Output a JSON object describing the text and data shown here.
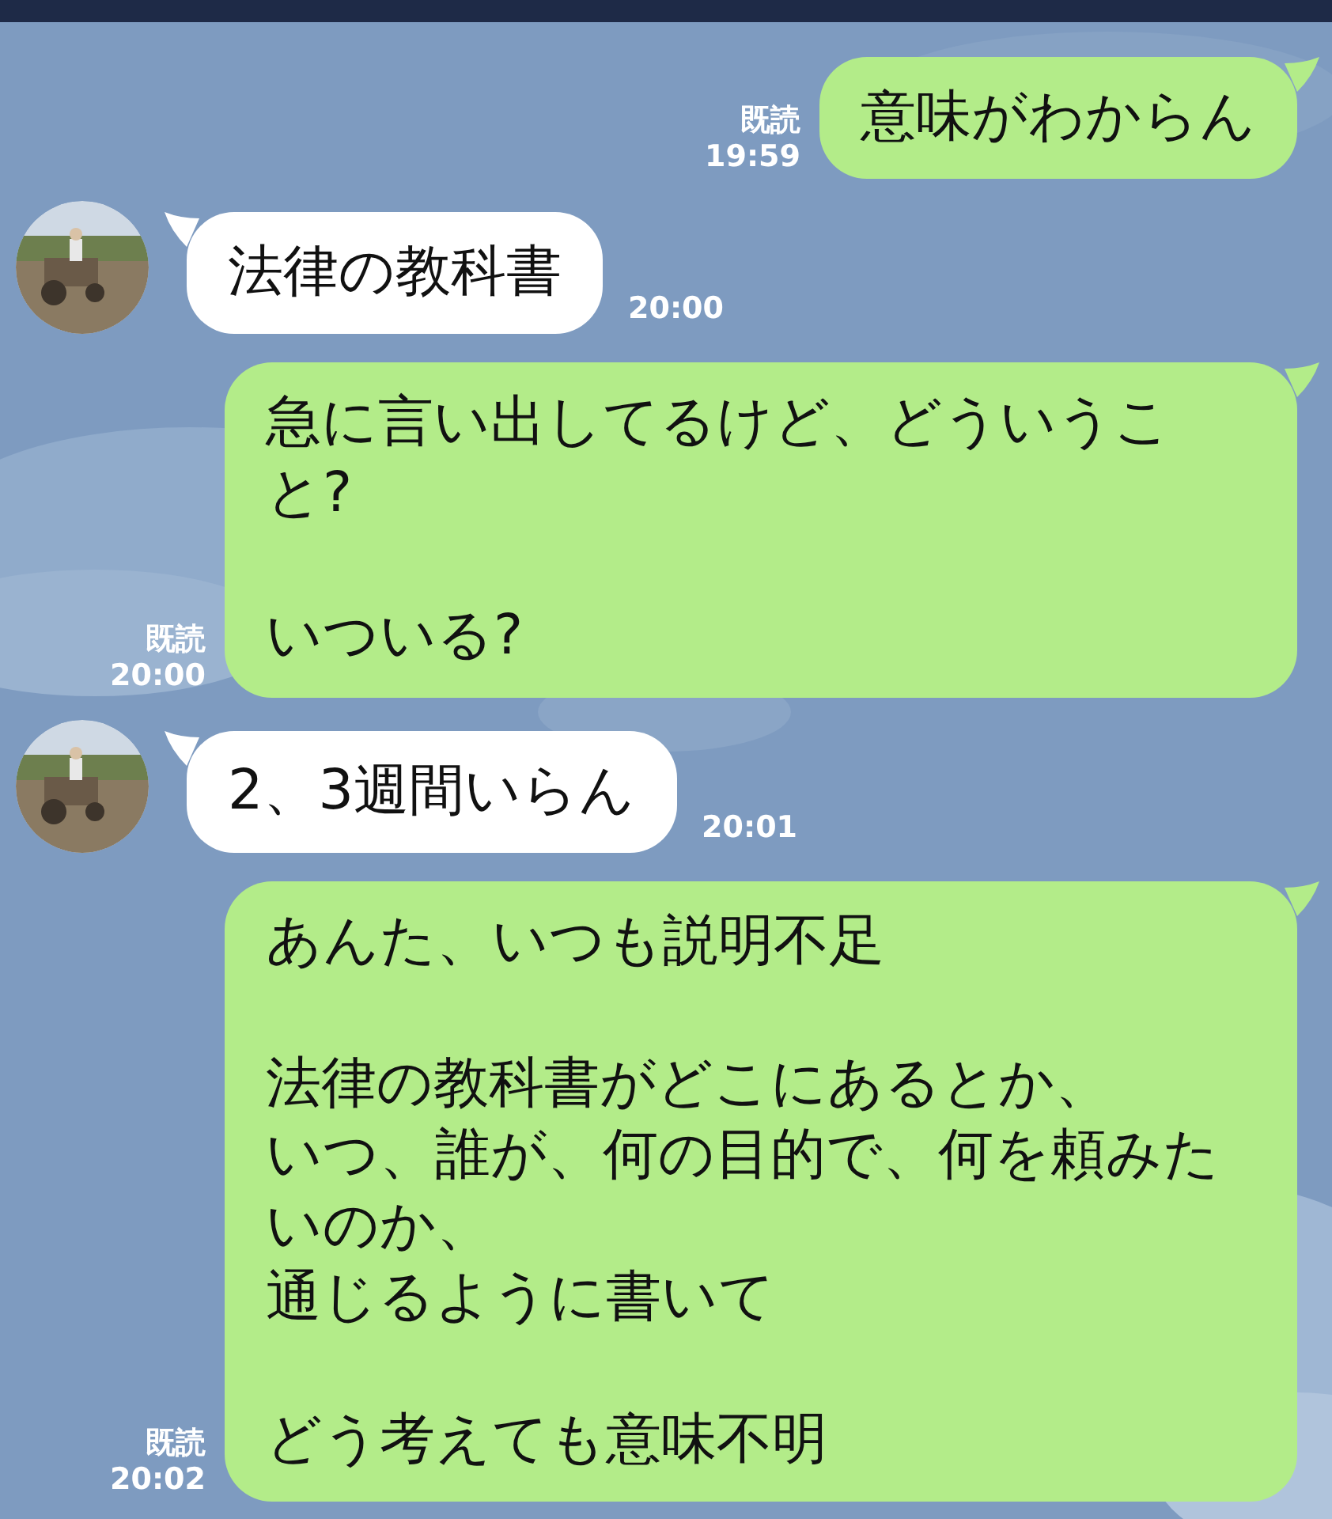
{
  "messages": [
    {
      "kind": "sent",
      "paragraphs": [
        [
          "意味がわからん"
        ]
      ],
      "read": "既読",
      "time": "19:59"
    },
    {
      "kind": "received",
      "paragraphs": [
        [
          "法律の教科書"
        ]
      ],
      "time": "20:00"
    },
    {
      "kind": "sent",
      "paragraphs": [
        [
          "急に言い出してるけど、どういうこと?"
        ],
        [
          "いついる?"
        ]
      ],
      "read": "既読",
      "time": "20:00"
    },
    {
      "kind": "received",
      "paragraphs": [
        [
          "2、3週間いらん"
        ]
      ],
      "time": "20:01"
    },
    {
      "kind": "sent",
      "paragraphs": [
        [
          "あんた、いつも説明不足"
        ],
        [
          "法律の教科書がどこにあるとか、",
          "いつ、誰が、何の目的で、何を頼みたいのか、",
          "通じるように書いて"
        ],
        [
          "どう考えても意味不明"
        ]
      ],
      "read": "既読",
      "time": "20:02"
    }
  ]
}
